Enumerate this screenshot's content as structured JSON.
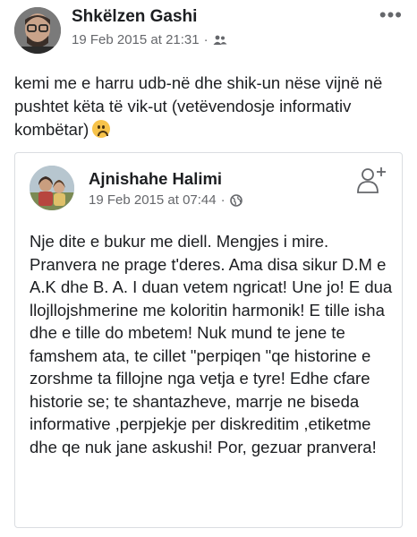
{
  "post": {
    "author": "Shkëlzen Gashi",
    "timestamp": "19 Feb 2015 at 21:31",
    "separator": "·",
    "audience_icon": "friends-icon",
    "more_label": "•••",
    "text": "kemi me e harru udb-në dhe shik-un nëse vijnë në pushtet këta të vik-ut (vetëvendosje informativ kombëtar)",
    "emoji": "frowning-face"
  },
  "shared": {
    "author": "Ajnishahe Halimi",
    "timestamp": "19 Feb 2015 at 07:44",
    "separator": "·",
    "audience_icon": "globe-icon",
    "follow_icon": "add-friend-icon",
    "text": "Nje dite e bukur me diell. Mengjes i mire. Pranvera ne prage t'deres. Ama disa sikur D.M e A.K  dhe B. A. I duan vetem ngricat! Une jo! E dua llojllojshmerine me koloritin harmonik! E tille isha dhe e tille do mbetem! Nuk mund te jene te famshem ata, te cillet \"perpiqen \"qe historine e zorshme ta fillojne nga vetja e tyre! Edhe cfare historie se; te shantazheve, marrje ne biseda informative ,perpjekje per diskreditim ,etiketme dhe qe nuk jane askushi! Por, gezuar  pranvera!"
  },
  "colors": {
    "text": "#1c1e21",
    "secondary": "#65676b",
    "border": "#dadde1"
  }
}
